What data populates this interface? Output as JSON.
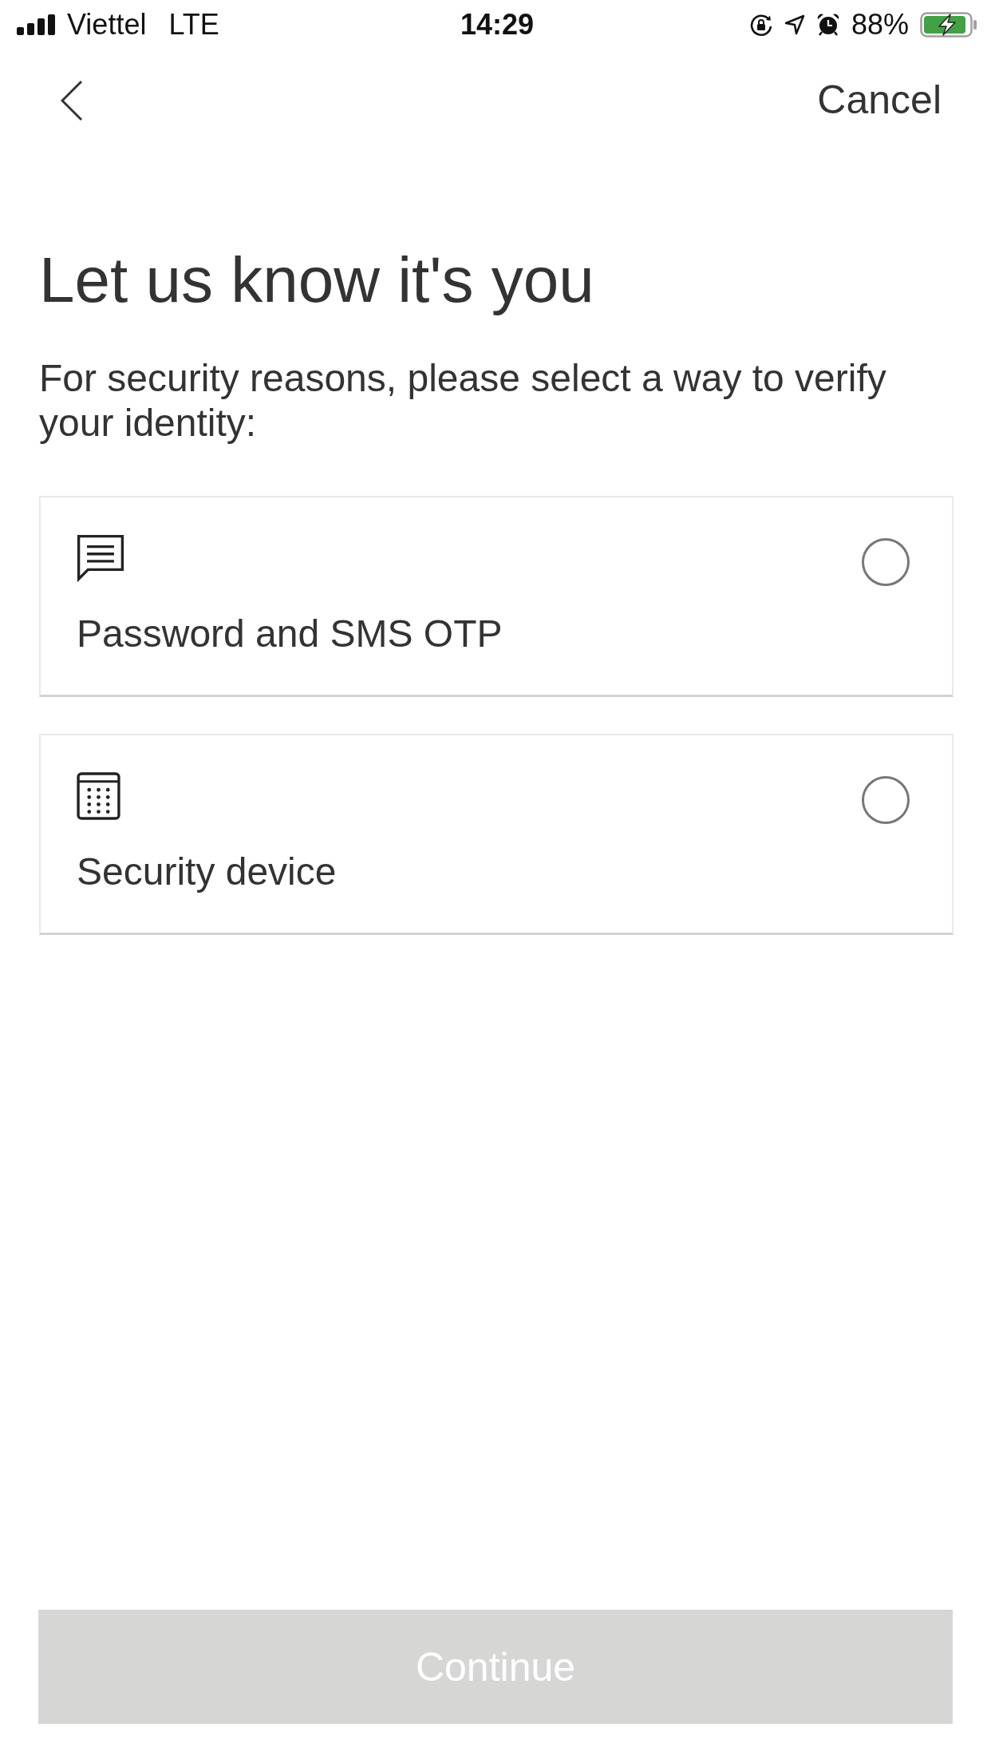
{
  "status_bar": {
    "carrier": "Viettel",
    "network": "LTE",
    "time": "14:29",
    "battery": "88%",
    "charging": true
  },
  "nav": {
    "cancel": "Cancel"
  },
  "title": "Let us know it's you",
  "subtitle": "For security reasons, please select a way to verify your identity:",
  "options": [
    {
      "kind": "sms",
      "label": "Password and SMS OTP",
      "selected": false
    },
    {
      "kind": "device",
      "label": "Security device",
      "selected": false
    }
  ],
  "continue_button": {
    "label": "Continue",
    "disabled": true
  }
}
